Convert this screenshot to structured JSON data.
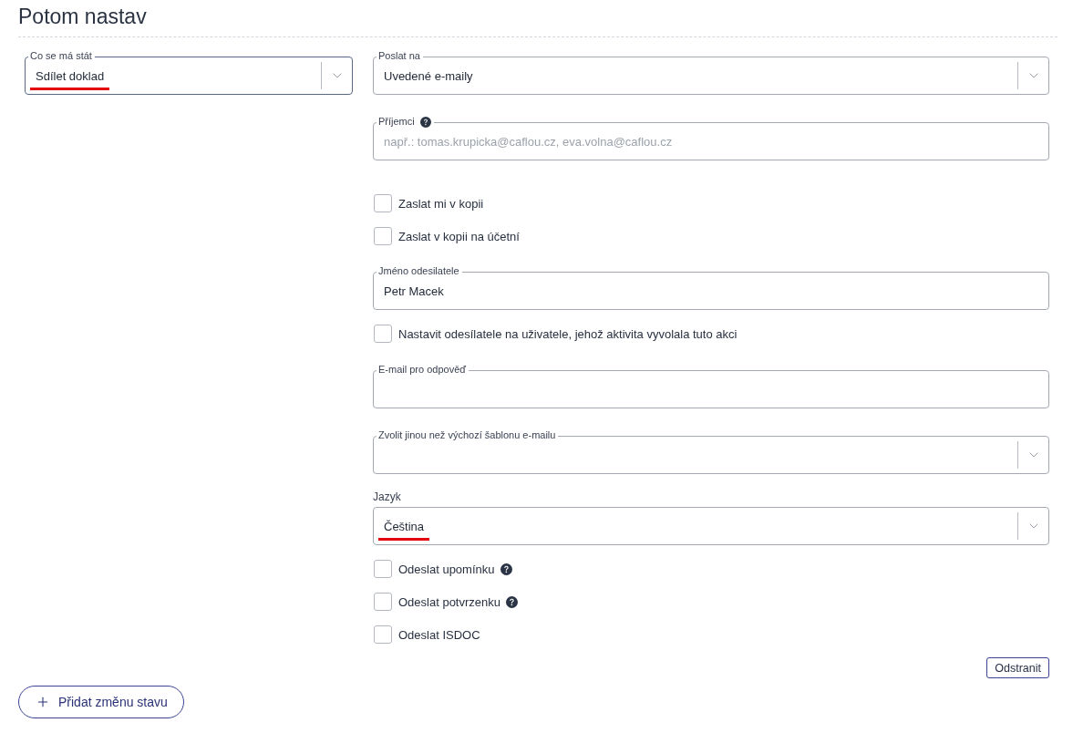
{
  "title": "Potom nastav",
  "action_select": {
    "label": "Co se má stát",
    "value": "Sdílet doklad",
    "underlined": true,
    "focused": true
  },
  "fields": [
    {
      "kind": "select",
      "label": "Poslat na",
      "label_above": false,
      "value": "Uvedené e-maily",
      "help": false,
      "underlined": false,
      "focused": false
    },
    {
      "kind": "input",
      "label": "Příjemci",
      "label_above": false,
      "placeholder": "např.: tomas.krupicka@caflou.cz, eva.volna@caflou.cz",
      "help": true,
      "focused": false
    },
    {
      "kind": "checkbox",
      "label": "Zaslat mi v kopii",
      "checked": false,
      "help": false
    },
    {
      "kind": "checkbox",
      "label": "Zaslat v kopii na účetní",
      "checked": false,
      "help": false
    },
    {
      "kind": "input",
      "label": "Jméno odesilatele",
      "label_above": false,
      "value": "Petr Macek",
      "help": false,
      "focused": false
    },
    {
      "kind": "checkbox",
      "label": "Nastavit odesílatele na uživatele, jehož aktivita vyvolala tuto akci",
      "checked": false,
      "help": false
    },
    {
      "kind": "input",
      "label": "E-mail pro odpověď",
      "label_above": false,
      "help": false,
      "focused": false
    },
    {
      "kind": "select",
      "label": "Zvolit jinou než výchozí šablonu e-mailu",
      "label_above": false,
      "help": false,
      "focused": false
    },
    {
      "kind": "select",
      "label": "Jazyk",
      "label_above": true,
      "value": "Čeština",
      "help": false,
      "underlined": true,
      "focused": false
    },
    {
      "kind": "checkbox",
      "label": "Odeslat upomínku",
      "checked": false,
      "help": true
    },
    {
      "kind": "checkbox",
      "label": "Odeslat potvrzenku",
      "checked": false,
      "help": true
    },
    {
      "kind": "checkbox",
      "label": "Odeslat ISDOC",
      "checked": false,
      "help": false
    }
  ],
  "remove_button": "Odstranit",
  "add_button": "Přidat změnu stavu"
}
